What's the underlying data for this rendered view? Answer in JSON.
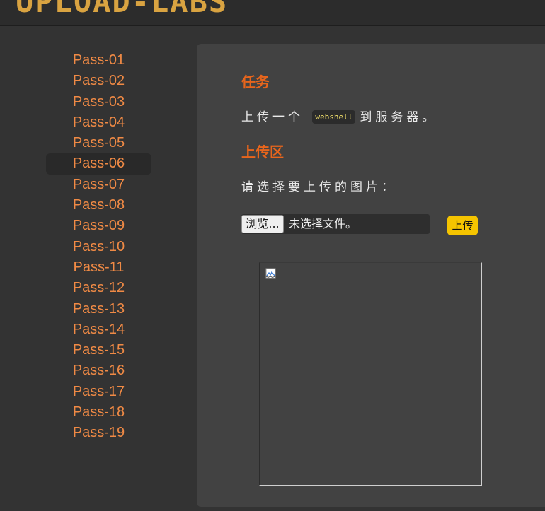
{
  "header": {
    "logo_text": "UPLOAD-LABS"
  },
  "sidebar": {
    "active_index": 5,
    "items": [
      {
        "label": "Pass-01"
      },
      {
        "label": "Pass-02"
      },
      {
        "label": "Pass-03"
      },
      {
        "label": "Pass-04"
      },
      {
        "label": "Pass-05"
      },
      {
        "label": "Pass-06"
      },
      {
        "label": "Pass-07"
      },
      {
        "label": "Pass-08"
      },
      {
        "label": "Pass-09"
      },
      {
        "label": "Pass-10"
      },
      {
        "label": "Pass-11"
      },
      {
        "label": "Pass-12"
      },
      {
        "label": "Pass-13"
      },
      {
        "label": "Pass-14"
      },
      {
        "label": "Pass-15"
      },
      {
        "label": "Pass-16"
      },
      {
        "label": "Pass-17"
      },
      {
        "label": "Pass-18"
      },
      {
        "label": "Pass-19"
      }
    ]
  },
  "task": {
    "heading": "任务",
    "text_before": "上传一个",
    "code": "webshell",
    "text_after": "到服务器。"
  },
  "upload_area": {
    "heading": "上传区",
    "prompt": "请选择要上传的图片：",
    "browse_label": "浏览...",
    "file_status": "未选择文件。",
    "submit_label": "上传"
  },
  "preview": {
    "icon": "broken-image-icon"
  },
  "colors": {
    "accent_orange": "#e8651c",
    "link_orange": "#f08a45",
    "upload_button": "#f5c400",
    "code_text": "#f5e36c"
  }
}
